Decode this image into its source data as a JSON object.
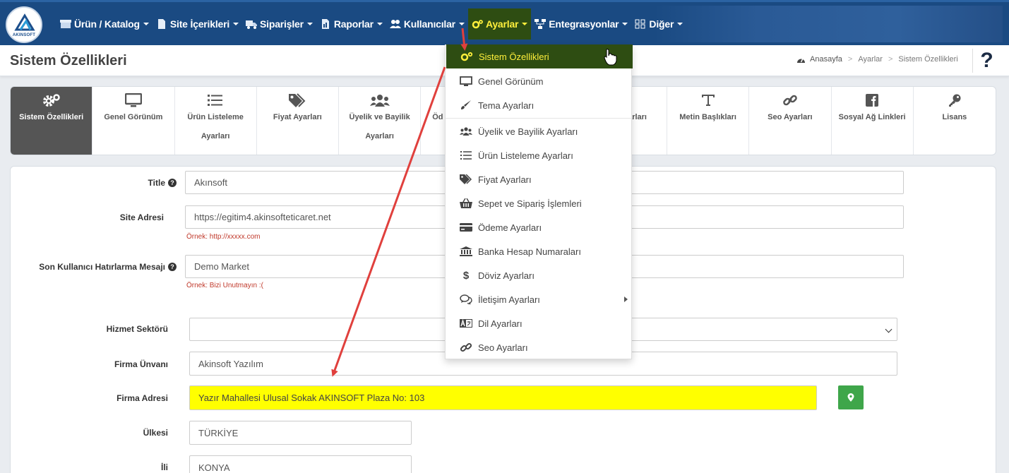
{
  "logo": {
    "text": "AKINSOFT"
  },
  "nav": {
    "items": [
      {
        "label": "Ürün / Katalog",
        "icon": "box-icon"
      },
      {
        "label": "Site İçerikleri",
        "icon": "file-icon"
      },
      {
        "label": "Siparişler",
        "icon": "truck-icon"
      },
      {
        "label": "Raporlar",
        "icon": "report-icon"
      },
      {
        "label": "Kullanıcılar",
        "icon": "users-icon"
      },
      {
        "label": "Ayarlar",
        "icon": "gears-icon"
      },
      {
        "label": "Entegrasyonlar",
        "icon": "sitemap-icon"
      },
      {
        "label": "Diğer",
        "icon": "grid-icon"
      }
    ]
  },
  "page": {
    "title": "Sistem Özellikleri",
    "breadcrumb": [
      "Anasayfa",
      "Ayarlar",
      "Sistem Özellikleri"
    ],
    "help": "?"
  },
  "tabs": [
    {
      "label": "Sistem Özellikleri",
      "icon": "gears-icon"
    },
    {
      "label": "Genel Görünüm",
      "icon": "monitor-icon"
    },
    {
      "label": "Ürün Listeleme Ayarları",
      "icon": "list-icon"
    },
    {
      "label": "Fiyat Ayarları",
      "icon": "tags-icon"
    },
    {
      "label": "Üyelik ve Bayilik Ayarları",
      "icon": "users-icon"
    },
    {
      "label": "Öd",
      "icon": "card-icon"
    },
    {
      "label": "",
      "icon": ""
    },
    {
      "label": "arları",
      "icon": "bank-icon"
    },
    {
      "label": "Metin Başlıkları",
      "icon": "text-height-icon"
    },
    {
      "label": "Seo Ayarları",
      "icon": "link-icon"
    },
    {
      "label": "Sosyal Ağ Linkleri",
      "icon": "facebook-icon"
    },
    {
      "label": "Lisans",
      "icon": "key-icon"
    }
  ],
  "form": {
    "title": {
      "label": "Title",
      "value": "Akınsoft"
    },
    "site_address": {
      "label": "Site Adresi",
      "value": "https://egitim4.akinsofteticaret.net",
      "hint": "Örnek: http://xxxxx.com"
    },
    "reminder": {
      "label": "Son Kullanıcı Hatırlarma Mesajı",
      "value": "Demo Market",
      "hint": "Örnek: Bizi Unutmayın :("
    },
    "sector": {
      "label": "Hizmet Sektörü",
      "value": ""
    },
    "company_title": {
      "label": "Firma Ünvanı",
      "value": "Akinsoft Yazılım"
    },
    "company_address": {
      "label": "Firma Adresi",
      "value": "Yazır Mahallesi Ulusal Sokak AKINSOFT Plaza No: 103"
    },
    "country": {
      "label": "Ülkesi",
      "value": "TÜRKİYE"
    },
    "city": {
      "label": "İli",
      "value": "KONYA"
    }
  },
  "dropdown": {
    "items": [
      {
        "label": "Sistem Özellikleri",
        "icon": "gears-icon"
      },
      {
        "label": "Genel Görünüm",
        "icon": "monitor-icon"
      },
      {
        "label": "Tema Ayarları",
        "icon": "brush-icon"
      },
      {
        "label": "Üyelik ve Bayilik Ayarları",
        "icon": "users-icon"
      },
      {
        "label": "Ürün Listeleme Ayarları",
        "icon": "list-icon"
      },
      {
        "label": "Fiyat Ayarları",
        "icon": "tags-icon"
      },
      {
        "label": "Sepet ve Sipariş İşlemleri",
        "icon": "basket-icon"
      },
      {
        "label": "Ödeme Ayarları",
        "icon": "card-icon"
      },
      {
        "label": "Banka Hesap Numaraları",
        "icon": "bank-icon"
      },
      {
        "label": "Döviz Ayarları",
        "icon": "dollar-icon"
      },
      {
        "label": "İletişim Ayarları",
        "icon": "comments-icon"
      },
      {
        "label": "Dil Ayarları",
        "icon": "language-icon"
      },
      {
        "label": "Seo Ayarları",
        "icon": "link-icon"
      }
    ]
  },
  "colors": {
    "nav_bg": "#1a4a82",
    "active_bg": "#2e4d12",
    "active_text": "#ffef3b",
    "highlight_field": "#ffff00",
    "arrow": "#e0403d",
    "map_button": "#3fa64a"
  }
}
